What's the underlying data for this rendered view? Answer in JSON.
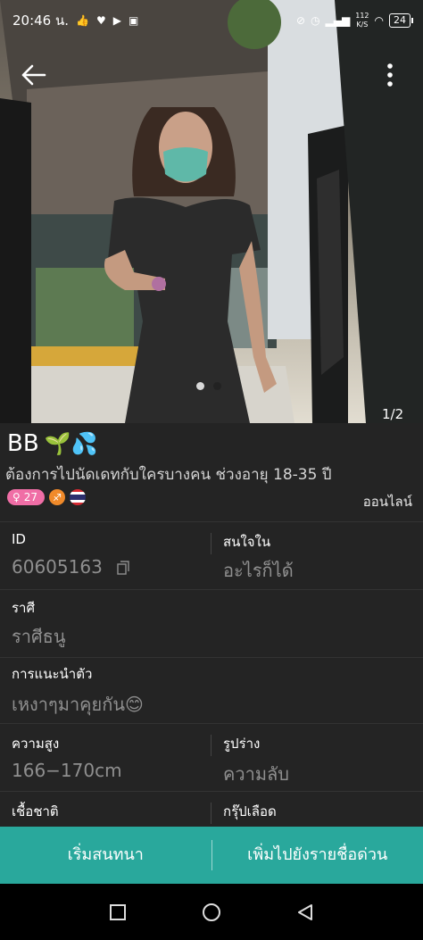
{
  "status_bar": {
    "time": "20:46 น.",
    "left_icons": [
      "hand-icon",
      "heart-icon",
      "play-icon",
      "app-icon"
    ],
    "speed_value": "112",
    "speed_unit": "K/S",
    "battery": "24"
  },
  "photo": {
    "page_counter": "1/2",
    "current_page": 1,
    "total_pages": 2
  },
  "profile": {
    "name": "BB",
    "name_emojis": "🌱💦",
    "description": "ต้องการไปนัดเดทกับใครบางคน ช่วงอายุ 18-35 ปี",
    "age": "27",
    "online_status": "ออนไลน์",
    "fields": {
      "id_label": "ID",
      "id_value": "60605163",
      "interest_label": "สนใจใน",
      "interest_value": "อะไรก็ได้",
      "zodiac_label": "ราศี",
      "zodiac_value": "ราศีธนู",
      "intro_label": "การแนะนำตัว",
      "intro_value": "เหงาๆมาคุยกัน😊",
      "height_label": "ความสูง",
      "height_value": "166−170cm",
      "body_label": "รูปร่าง",
      "body_value": "ความลับ",
      "ethnicity_label": "เชื้อชาติ",
      "blood_label": "กรุ๊ปเลือด"
    }
  },
  "actions": {
    "start_chat": "เริ่มสนทนา",
    "add_favorite": "เพิ่มไปยังรายชื่อด่วน"
  },
  "colors": {
    "action_bar": "#29a89c",
    "age_badge": "#f06ea6",
    "zodiac_badge": "#f08a2a",
    "panel_bg": "#242424"
  }
}
